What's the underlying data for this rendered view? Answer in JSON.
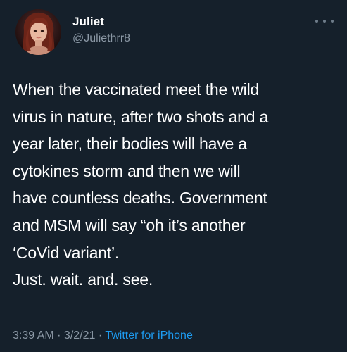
{
  "author": {
    "display_name": "Juliet",
    "handle": "@Juliethrr8",
    "avatar": "profile-photo"
  },
  "menu_icon": "more-horizontal-icon",
  "tweet": {
    "lines": [
      "When the vaccinated meet the wild",
      "virus in nature, after two shots and a",
      "year later, their bodies will have a",
      "cytokines storm and then we will",
      "have countless deaths. Government",
      "and MSM will say “oh it’s another",
      "‘CoVid variant’.",
      "Just. wait. and. see."
    ]
  },
  "meta": {
    "time": "3:39 AM",
    "separator_1": " · ",
    "date": "3/2/21",
    "separator_2": " · ",
    "source": "Twitter for iPhone"
  },
  "colors": {
    "background": "#15202b",
    "text_primary": "#ffffff",
    "text_secondary": "#8b98a5",
    "link": "#1d9bf0"
  }
}
